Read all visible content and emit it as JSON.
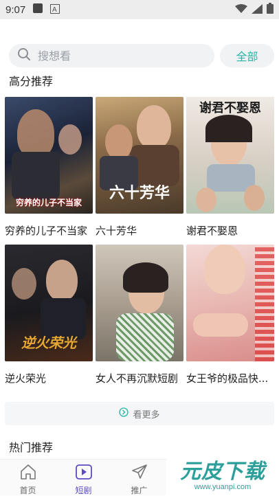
{
  "status_bar": {
    "time": "9:07"
  },
  "search": {
    "placeholder": "搜想看",
    "all_button": "全部"
  },
  "sections": {
    "high_score": "高分推荐",
    "hot": "热门推荐"
  },
  "dramas": [
    {
      "title": "穷养的儿子不当家",
      "poster_caption": "穷养的儿子不当家"
    },
    {
      "title": "六十芳华",
      "poster_caption": "六十芳华"
    },
    {
      "title": "谢君不娶恩",
      "poster_caption": "谢君不娶恩"
    },
    {
      "title": "逆火荣光",
      "poster_caption": "逆火荣光"
    },
    {
      "title": "女人不再沉默短剧",
      "poster_caption": ""
    },
    {
      "title": "女王爷的极品快...",
      "poster_caption": ""
    }
  ],
  "more_button": "看更多",
  "tabs": [
    {
      "label": "首页",
      "icon": "home-icon"
    },
    {
      "label": "短剧",
      "icon": "play-icon"
    },
    {
      "label": "推广",
      "icon": "send-icon"
    }
  ],
  "watermark": {
    "title": "元皮下载",
    "url": "www.yuanpi.com"
  },
  "colors": {
    "accent": "#25b4a6",
    "tab_active": "#5b4bc4"
  }
}
